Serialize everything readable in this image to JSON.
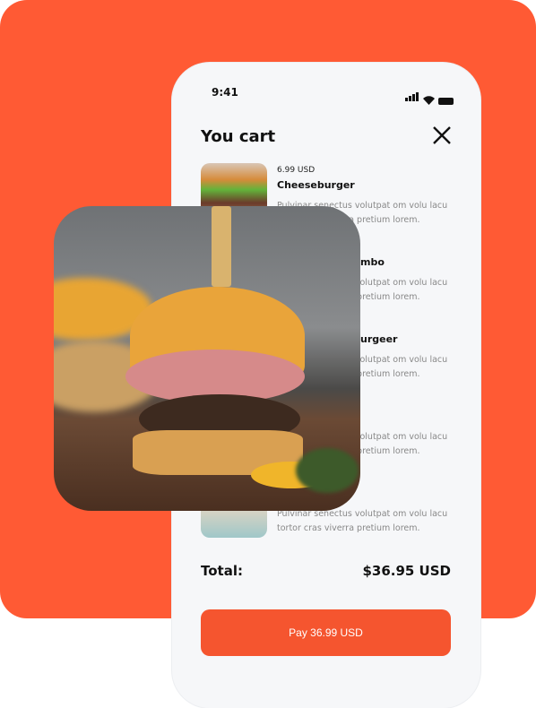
{
  "colors": {
    "brand": "#ff5a34",
    "button": "#f5552f"
  },
  "status": {
    "time": "9:41",
    "icons": [
      "signal-icon",
      "wifi-icon",
      "battery-icon"
    ]
  },
  "cart": {
    "title": "You cart",
    "close_icon": "close-icon",
    "items": [
      {
        "price": "6.99 USD",
        "name": "Cheeseburger",
        "desc": "Pulvinar senectus volutpat om volu lacu tortor cras viverra pretium lorem."
      },
      {
        "name": "mbo",
        "desc": "Pulvinar senectus volutpat om volu lacu tortor cras viverra pretium lorem."
      },
      {
        "name": "urgeer",
        "desc": "Pulvinar senectus volutpat om volu lacu tortor cras viverra pretium lorem."
      },
      {
        "desc": "Pulvinar senectus volutpat om volu lacu tortor cras viverra pretium lorem."
      },
      {
        "desc": "Pulvinar senectus volutpat om volu lacu tortor cras viverra pretium lorem."
      }
    ],
    "total_label": "Total:",
    "total_value": "$36.95 USD",
    "pay_label": "Pay 36.99 USD"
  }
}
